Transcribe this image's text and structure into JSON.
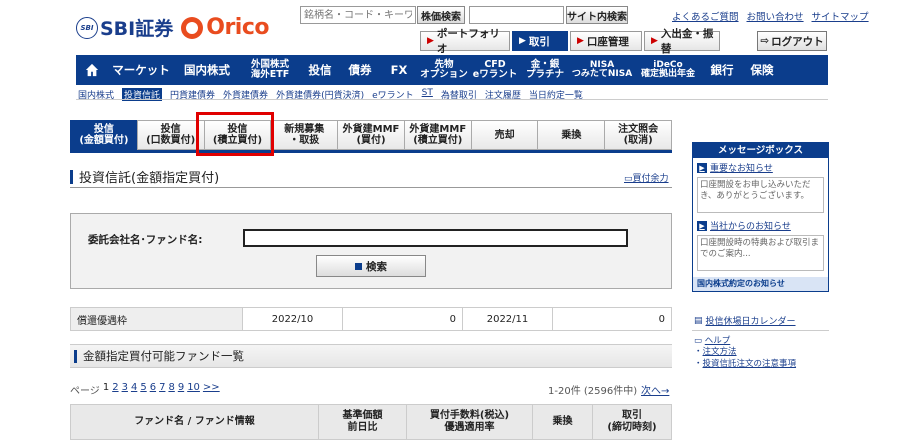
{
  "header": {
    "brand_sbi_badge": "SBI",
    "brand_sbi": "SBI証券",
    "brand_orico": "Orico",
    "search_placeholder": "銘柄名・コード・キーワ",
    "stock_search_label": "株価検索",
    "site_search_label": "サイト内検索",
    "util_links": [
      "よくあるご質問",
      "お問い合わせ",
      "サイトマップ"
    ],
    "actions": [
      "ポートフォリオ",
      "取引",
      "口座管理",
      "入出金・振替"
    ],
    "logout_label": "ログアウト"
  },
  "main_nav": [
    {
      "label": "マーケット"
    },
    {
      "label": "国内株式"
    },
    {
      "label": "外国株式\n海外ETF"
    },
    {
      "label": "投信"
    },
    {
      "label": "債券"
    },
    {
      "label": "FX"
    },
    {
      "label": "先物\nオプション"
    },
    {
      "label": "CFD\neワラント"
    },
    {
      "label": "金・銀\nプラチナ"
    },
    {
      "label": "NISA\nつみたてNISA"
    },
    {
      "label": "iDeCo\n確定拠出年金"
    },
    {
      "label": "銀行"
    },
    {
      "label": "保険"
    }
  ],
  "sub_nav": [
    "国内株式",
    "投資信託",
    "円貨建債券",
    "外貨建債券",
    "外貨建債券(円貨決済)",
    "eワラント",
    "ST",
    "為替取引",
    "注文履歴",
    "当日約定一覧"
  ],
  "tabs": [
    "投信\n(金額買付)",
    "投信\n(口数買付)",
    "投信\n(積立買付)",
    "新規募集\n・取扱",
    "外貨建MMF\n(買付)",
    "外貨建MMF\n(積立買付)",
    "売却",
    "乗換",
    "注文照会\n(取消)"
  ],
  "page": {
    "title": "投資信託(金額指定買付)",
    "print_label": "買付余力",
    "fund_label": "委託会社名･ファンド名:",
    "search_button": "検索"
  },
  "redemption": {
    "label": "償還優遇枠",
    "period1": "2022/10",
    "value1": "0",
    "period2": "2022/11",
    "value2": "0"
  },
  "fund_list": {
    "title": "金額指定買付可能ファンド一覧",
    "page_label": "ページ",
    "pages": [
      "1",
      "2",
      "3",
      "4",
      "5",
      "6",
      "7",
      "8",
      "9",
      "10",
      ">>"
    ],
    "count": "1-20件 (2596件中)",
    "next": "次へ→",
    "columns": [
      "ファンド名 / ファンド情報",
      "基準価額\n前日比",
      "買付手数料(税込)\n優遇適用率",
      "乗換",
      "取引\n(締切時刻)"
    ]
  },
  "sidebar": {
    "msg_title": "メッセージボックス",
    "important_label": "重要なお知らせ",
    "important_text": "口座開設をお申し込みいただき、ありがとうございます。",
    "notice_label": "当社からのお知らせ",
    "notice_text": "口座開設時の特典および取引までのご案内...",
    "msg_foot": "国内株式約定のお知らせ",
    "calendar_label": "投信休場日カレンダー",
    "help_items": [
      "ヘルプ",
      "注文方法",
      "投資信託注文の注意事項"
    ]
  }
}
